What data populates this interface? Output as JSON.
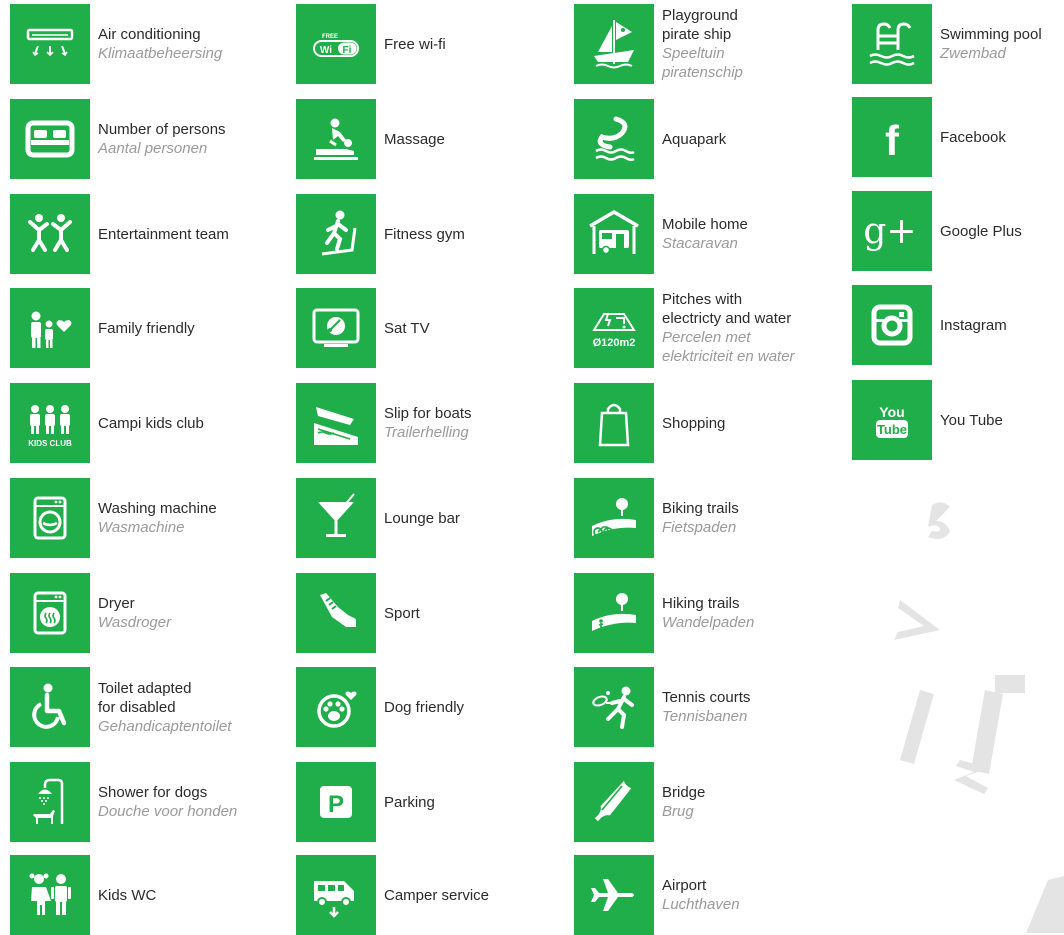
{
  "columns": [
    {
      "items": [
        {
          "label": "Air conditioning",
          "sub": "Klimaatbeheersing",
          "icon": "air-conditioning-icon"
        },
        {
          "label": "Number of persons",
          "sub": "Aantal personen",
          "icon": "bed-icon"
        },
        {
          "label": "Entertainment team",
          "sub": "",
          "icon": "entertainment-icon"
        },
        {
          "label": "Family friendly",
          "sub": "",
          "icon": "family-icon"
        },
        {
          "label": "Campi kids club",
          "sub": "",
          "icon": "kids-club-icon",
          "badge": "KIDS CLUB"
        },
        {
          "label": "Washing machine",
          "sub": "Wasmachine",
          "icon": "washing-machine-icon"
        },
        {
          "label": "Dryer",
          "sub": "Wasdroger",
          "icon": "dryer-icon"
        },
        {
          "label": "Toilet adapted\nfor disabled",
          "sub": "Gehandicaptentoilet",
          "icon": "wheelchair-icon"
        },
        {
          "label": "Shower for dogs",
          "sub": "Douche voor honden",
          "icon": "dog-shower-icon"
        },
        {
          "label": "Kids WC",
          "sub": "",
          "icon": "kids-wc-icon"
        }
      ]
    },
    {
      "items": [
        {
          "label": "Free wi-fi",
          "sub": "",
          "icon": "wifi-icon",
          "badge": "FREE",
          "badge2": "Wi",
          "badge3": "Fi"
        },
        {
          "label": "Massage",
          "sub": "",
          "icon": "massage-icon"
        },
        {
          "label": "Fitness gym",
          "sub": "",
          "icon": "treadmill-icon"
        },
        {
          "label": "Sat TV",
          "sub": "",
          "icon": "sat-tv-icon"
        },
        {
          "label": "Slip for boats",
          "sub": "Trailerhelling",
          "icon": "boat-slip-icon"
        },
        {
          "label": "Lounge bar",
          "sub": "",
          "icon": "cocktail-icon"
        },
        {
          "label": "Sport",
          "sub": "",
          "icon": "sport-shoe-icon"
        },
        {
          "label": "Dog friendly",
          "sub": "",
          "icon": "dog-paw-icon"
        },
        {
          "label": "Parking",
          "sub": "",
          "icon": "parking-icon",
          "badge": "P"
        },
        {
          "label": "Camper service",
          "sub": "",
          "icon": "camper-icon"
        }
      ]
    },
    {
      "items": [
        {
          "label": "Playground\npirate ship",
          "sub": "Speeltuin\npiratenschip",
          "icon": "pirate-ship-icon"
        },
        {
          "label": "Aquapark",
          "sub": "",
          "icon": "aquapark-icon"
        },
        {
          "label": "Mobile home",
          "sub": "Stacaravan",
          "icon": "mobile-home-icon"
        },
        {
          "label": "Pitches with\nelectricty and water",
          "sub": "Percelen met\nelektriciteit en water",
          "icon": "pitch-icon",
          "badge": "Ø120m2"
        },
        {
          "label": "Shopping",
          "sub": "",
          "icon": "shopping-bag-icon"
        },
        {
          "label": "Biking trails",
          "sub": "Fietspaden",
          "icon": "biking-icon"
        },
        {
          "label": "Hiking trails",
          "sub": "Wandelpaden",
          "icon": "hiking-icon"
        },
        {
          "label": "Tennis courts",
          "sub": "Tennisbanen",
          "icon": "tennis-icon"
        },
        {
          "label": "Bridge",
          "sub": "Brug",
          "icon": "bridge-icon"
        },
        {
          "label": "Airport",
          "sub": "Luchthaven",
          "icon": "airplane-icon"
        }
      ]
    },
    {
      "items": [
        {
          "label": "Swimming pool",
          "sub": "Zwembad",
          "icon": "swimming-pool-icon"
        },
        {
          "label": "Facebook",
          "sub": "",
          "icon": "facebook-icon",
          "badge": "f"
        },
        {
          "label": "Google Plus",
          "sub": "",
          "icon": "google-plus-icon",
          "badge": "g+"
        },
        {
          "label": "Instagram",
          "sub": "",
          "icon": "instagram-icon"
        },
        {
          "label": "You Tube",
          "sub": "",
          "icon": "youtube-icon",
          "badge": "You",
          "badge2": "Tube"
        }
      ]
    }
  ],
  "colors": {
    "tile": "#1fae49",
    "label": "#2b2b2b",
    "sub": "#9a9a9a"
  }
}
